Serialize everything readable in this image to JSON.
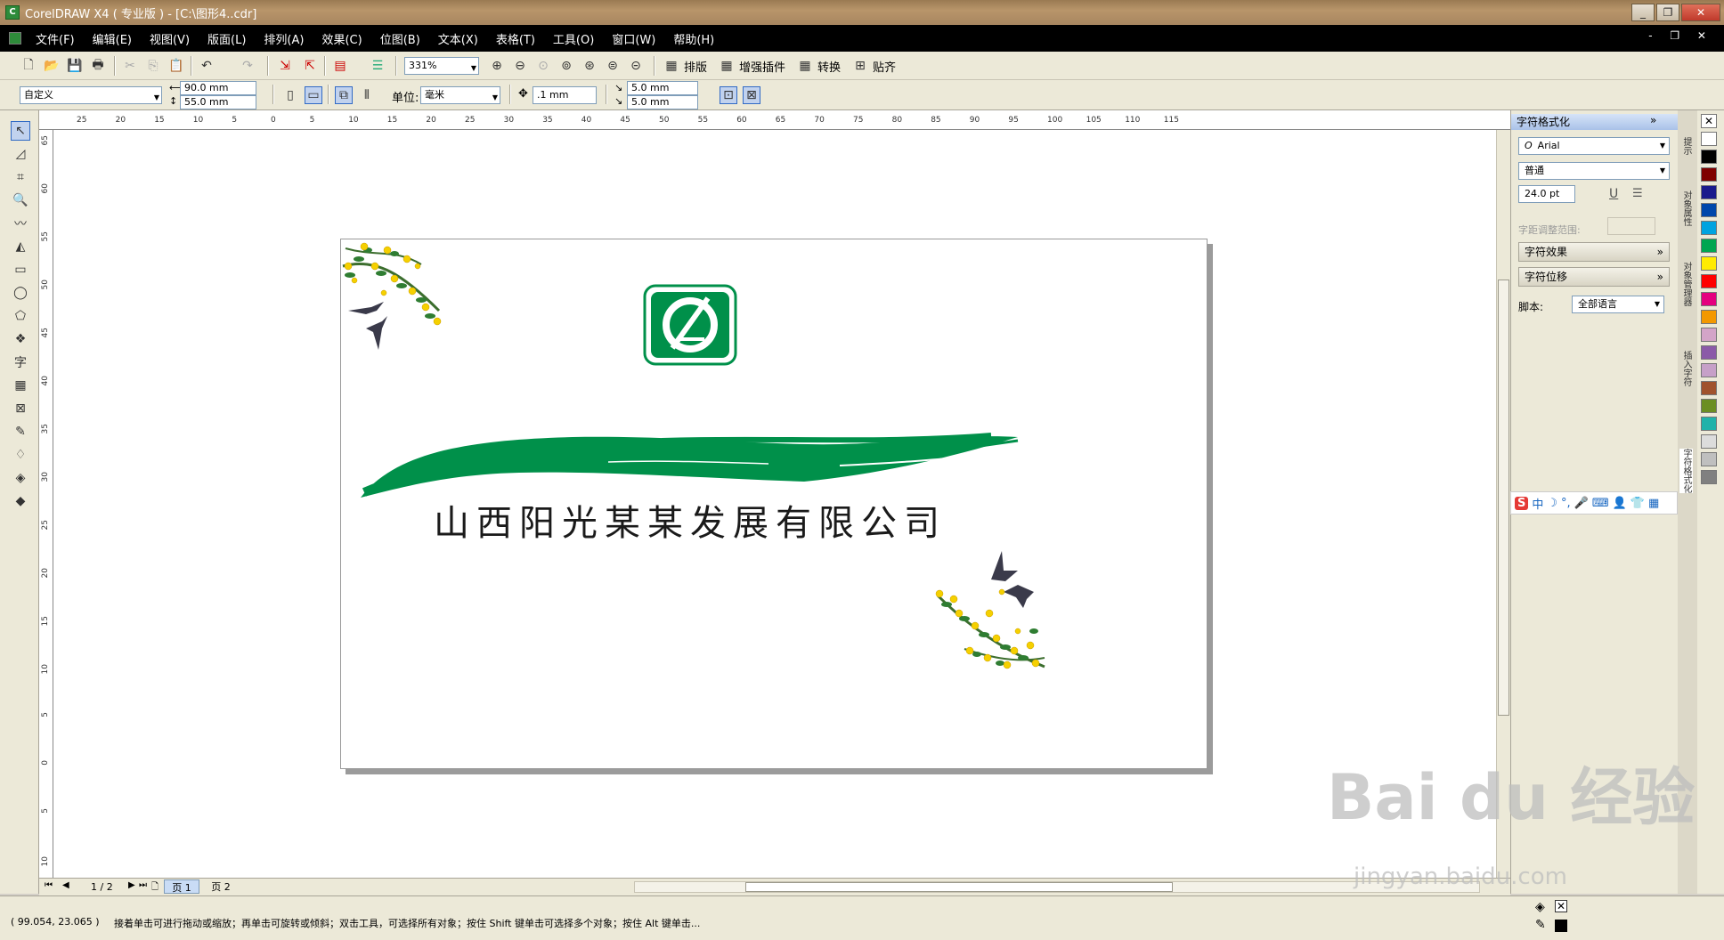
{
  "window": {
    "title": "CorelDRAW X4 ( 专业版 ) - [C:\\图形4..cdr]"
  },
  "menu": [
    "文件(F)",
    "编辑(E)",
    "视图(V)",
    "版面(L)",
    "排列(A)",
    "效果(C)",
    "位图(B)",
    "文本(X)",
    "表格(T)",
    "工具(O)",
    "窗口(W)",
    "帮助(H)"
  ],
  "toolbar": {
    "zoom": "331%",
    "buttons": [
      "排版",
      "增强插件",
      "转换",
      "贴齐"
    ]
  },
  "propbar": {
    "page_size": "自定义",
    "width": "90.0 mm",
    "height": "55.0 mm",
    "unit_label": "单位:",
    "unit": "毫米",
    "nudge": ".1 mm",
    "dup_x": "5.0 mm",
    "dup_y": "5.0 mm"
  },
  "ruler": {
    "h": [
      "25",
      "20",
      "15",
      "10",
      "5",
      "0",
      "5",
      "10",
      "15",
      "20",
      "25",
      "30",
      "35",
      "40",
      "45",
      "50",
      "55",
      "60",
      "65",
      "70",
      "75",
      "80",
      "85",
      "90",
      "95",
      "100",
      "105",
      "110",
      "115"
    ],
    "v": [
      "65",
      "60",
      "55",
      "50",
      "45",
      "40",
      "35",
      "30",
      "25",
      "20",
      "15",
      "10",
      "5",
      "0",
      "5",
      "10"
    ]
  },
  "document": {
    "company": "山西阳光某某发展有限公司",
    "brand_green": "#00904a"
  },
  "pages": {
    "counter": "1 / 2",
    "tabs": [
      "页 1",
      "页 2"
    ]
  },
  "status": {
    "coords": "( 99.054, 23.065 )",
    "hint": "接着单击可进行拖动或缩放；再单击可旋转或倾斜；双击工具，可选择所有对象；按住 Shift 键单击可选择多个对象；按住 Alt 键单击..."
  },
  "docker": {
    "title": "字符格式化",
    "font": "Arial",
    "style": "普通",
    "size": "24.0 pt",
    "kerning_label": "字距调整范围:",
    "effects": "字符效果",
    "shift": "字符位移",
    "script_label": "脚本:",
    "script_value": "全部语言"
  },
  "ime": [
    "中",
    "☽",
    "°,",
    "🎤",
    "⌨",
    "👤",
    "👕",
    "▦"
  ],
  "palette": [
    "#ffffff",
    "#000000",
    "#7f0000",
    "#1a1a8c",
    "#0047ab",
    "#00a3e0",
    "#00a651",
    "#ffeb00",
    "#ff0000",
    "#e4007f",
    "#f39800",
    "#d3a4c8",
    "#8b5aa8",
    "#c6a0c8",
    "#a0522d",
    "#6b8e23",
    "#20b2aa",
    "#dcdcdc",
    "#bfbfbf",
    "#808080"
  ],
  "watermark": {
    "main": "Bai du 经验",
    "sub": "jingyan.baidu.com"
  }
}
